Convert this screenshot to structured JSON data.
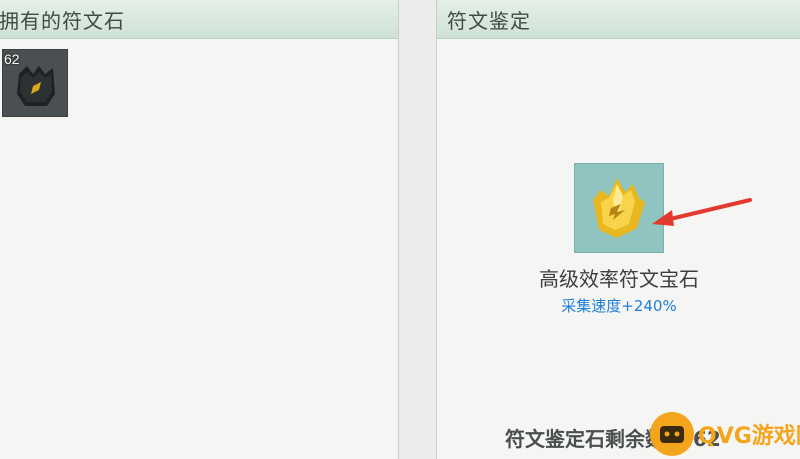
{
  "left_panel": {
    "title": "拥有的符文石"
  },
  "inventory": [
    {
      "count": "62",
      "icon": "dark-rune-stone-icon"
    }
  ],
  "right_panel": {
    "title": "符文鉴定"
  },
  "appraise": {
    "gem_icon": "gold-rune-gem-icon",
    "gem_name": "高级效率符文宝石",
    "gem_effect": "采集速度+240%",
    "remaining_text": "符文鉴定石剩余数量:62",
    "effect_color": "#1f7fd6",
    "arrow_color": "#e23a2e"
  },
  "watermark": {
    "icon": "gamepad-icon",
    "text": "QVG游戏网",
    "color": "#f4a51c"
  }
}
